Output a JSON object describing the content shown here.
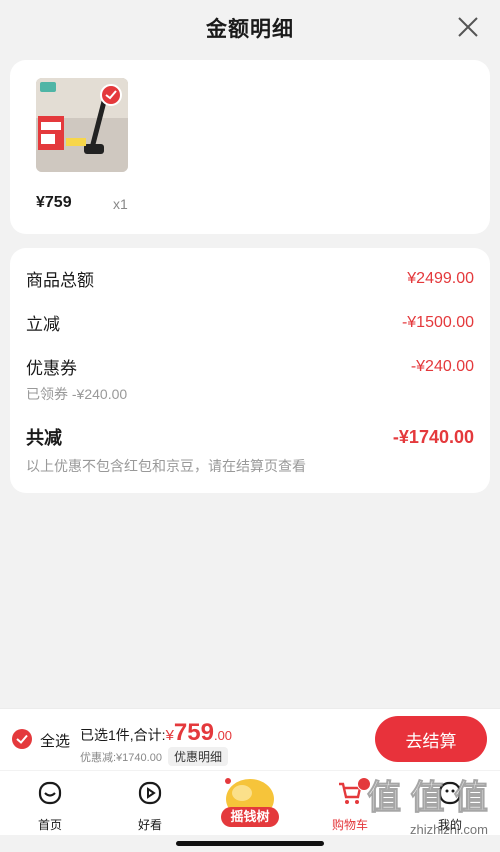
{
  "header": {
    "title": "金额明细"
  },
  "product": {
    "price": "¥759",
    "quantity": "x1"
  },
  "summary": {
    "subtotal_label": "商品总额",
    "subtotal_value": "¥2499.00",
    "discount_label": "立减",
    "discount_value": "-¥1500.00",
    "coupon_label": "优惠券",
    "coupon_value": "-¥240.00",
    "coupon_note": "已领券 -¥240.00",
    "total_label": "共减",
    "total_value": "-¥1740.00",
    "total_note": "以上优惠不包含红包和京豆，请在结算页查看"
  },
  "checkout": {
    "select_all": "全选",
    "selected_text": "已选1件,合计:",
    "currency": "¥",
    "amount_int": "759",
    "amount_dec": ".00",
    "discount_text": "优惠减:¥1740.00",
    "detail_chip": "优惠明细",
    "button": "去结算"
  },
  "tabs": [
    {
      "label": "首页"
    },
    {
      "label": "好看"
    },
    {
      "label": "摇钱树"
    },
    {
      "label": "购物车"
    },
    {
      "label": "我的"
    }
  ],
  "watermark": {
    "text": "值 值 值",
    "url": "zhizhizhi.com"
  },
  "colors": {
    "accent": "#e4393c"
  }
}
